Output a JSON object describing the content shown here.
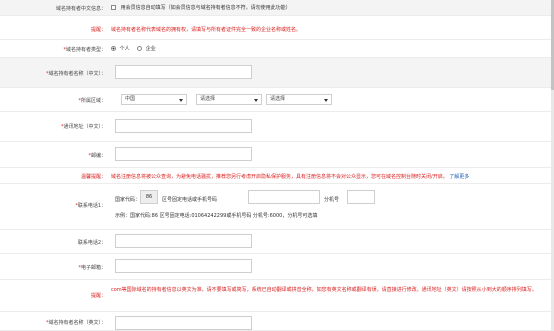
{
  "row1": {
    "label": "域名持有者中文信息：",
    "checkbox_text": "用会员信息自动填写（如会员信息与域名持有者信息不符，请勿使用此功能）"
  },
  "row2": {
    "label": "提醒：",
    "text": "域名持有者名称代表域名的拥有权，请填写与所有者证件完全一致的企业名称或姓名。"
  },
  "row3": {
    "label": "域名持有者类型：",
    "opt1": "个人",
    "opt2": "企业"
  },
  "row4": {
    "label": "域名持有者名称（中文）："
  },
  "row5": {
    "label": "所属区域：",
    "country": "中国",
    "province": "请选择",
    "city": "请选择"
  },
  "row6": {
    "label": "通讯地址（中文）："
  },
  "row7": {
    "label": "邮编："
  },
  "row8": {
    "label": "温馨提醒：",
    "text": "域名注册信息将被公众查询，为避免电话骚扰，推荐您另行考虑开启隐私保护服务，具有注册信息将不会对公众显示，您可在域名控制台随时关闭/开启。",
    "link": "了解更多"
  },
  "row9": {
    "label": "联系电话1：",
    "country_code_label": "国家代码：",
    "country_code_value": "86",
    "area_label": "区号固定电话或手机号码",
    "ext_label": "分机号",
    "example": "示例：国家代码:86 区号固定电话:01064242299或手机号码 分机号:6000，分机号可选填"
  },
  "row10": {
    "label": "联系电话2："
  },
  "row11": {
    "label": "电子邮箱："
  },
  "row12": {
    "label": "提醒：",
    "text": "com等国际域名的持有者信息以英文为准，请不要填写或简写，系统已自动翻译或拼音全称，如您有英文名称或翻译有误，请直接进行修改。通讯地址（英文）请按照从小到大的顺序排列填写。"
  },
  "row13": {
    "label": "域名持有者名称（英文）："
  }
}
